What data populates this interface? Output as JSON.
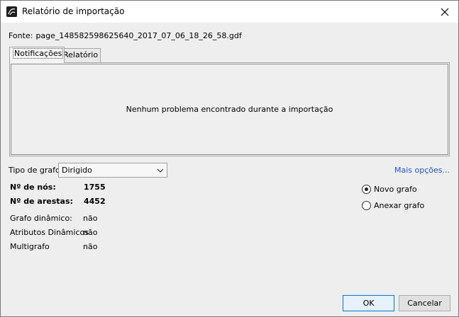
{
  "window": {
    "title": "Relatório de importação",
    "icon": "gephi-app-icon",
    "close_icon": "close-icon"
  },
  "source": {
    "label": "Fonte:",
    "file": "page_148582598625640_2017_07_06_18_26_58.gdf"
  },
  "tabs": [
    {
      "label": "Notificações",
      "active": true
    },
    {
      "label": "Relatório",
      "active": false
    }
  ],
  "panel": {
    "message": "Nenhum problema encontrado durante a importação"
  },
  "graph_type": {
    "label": "Tipo de grafo:",
    "value": "Dirigido"
  },
  "more_options": "Mais opções...",
  "stats": {
    "nodes_label": "Nº de nós:",
    "nodes_value": "1755",
    "edges_label": "Nº de arestas:",
    "edges_value": "4452"
  },
  "meta": [
    {
      "label": "Grafo dinâmico:",
      "value": "não"
    },
    {
      "label": "Atributos Dinâmicos",
      "value": "não"
    },
    {
      "label": "Multigrafo",
      "value": "não"
    }
  ],
  "options": [
    {
      "label": "Novo grafo",
      "checked": true
    },
    {
      "label": "Anexar grafo",
      "checked": false
    }
  ],
  "buttons": {
    "ok": "OK",
    "cancel": "Cancelar"
  },
  "colors": {
    "link": "#1f57c3",
    "ok_border": "#0078d7"
  }
}
